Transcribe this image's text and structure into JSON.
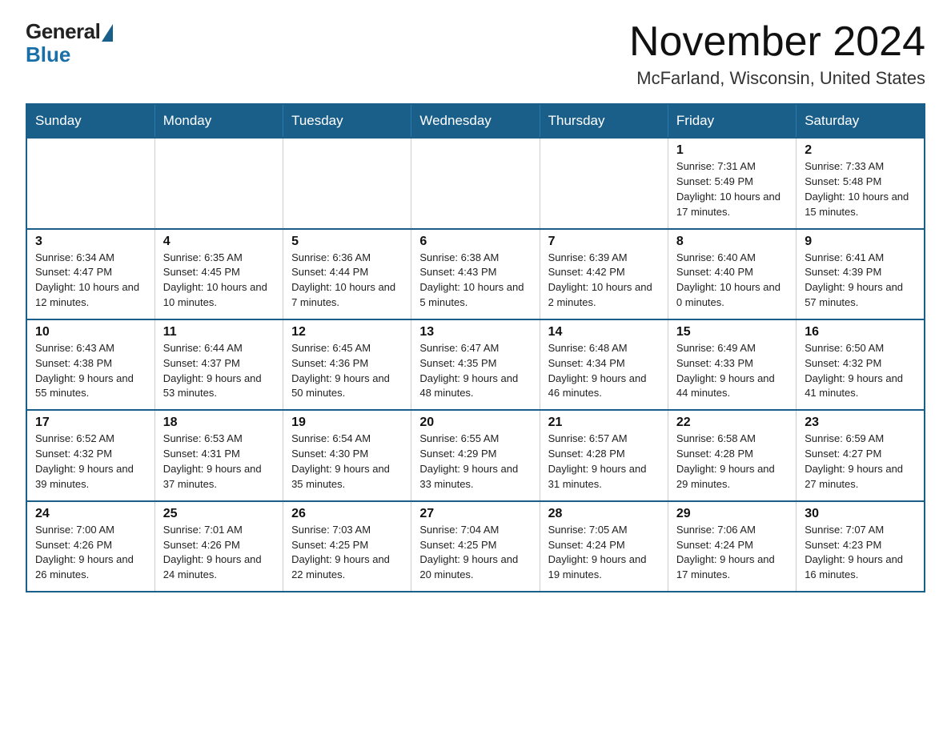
{
  "logo": {
    "text_general": "General",
    "text_blue": "Blue"
  },
  "header": {
    "title": "November 2024",
    "subtitle": "McFarland, Wisconsin, United States"
  },
  "days_of_week": [
    "Sunday",
    "Monday",
    "Tuesday",
    "Wednesday",
    "Thursday",
    "Friday",
    "Saturday"
  ],
  "weeks": [
    {
      "cells": [
        {
          "day": "",
          "info": ""
        },
        {
          "day": "",
          "info": ""
        },
        {
          "day": "",
          "info": ""
        },
        {
          "day": "",
          "info": ""
        },
        {
          "day": "",
          "info": ""
        },
        {
          "day": "1",
          "info": "Sunrise: 7:31 AM\nSunset: 5:49 PM\nDaylight: 10 hours\nand 17 minutes."
        },
        {
          "day": "2",
          "info": "Sunrise: 7:33 AM\nSunset: 5:48 PM\nDaylight: 10 hours\nand 15 minutes."
        }
      ]
    },
    {
      "cells": [
        {
          "day": "3",
          "info": "Sunrise: 6:34 AM\nSunset: 4:47 PM\nDaylight: 10 hours\nand 12 minutes."
        },
        {
          "day": "4",
          "info": "Sunrise: 6:35 AM\nSunset: 4:45 PM\nDaylight: 10 hours\nand 10 minutes."
        },
        {
          "day": "5",
          "info": "Sunrise: 6:36 AM\nSunset: 4:44 PM\nDaylight: 10 hours\nand 7 minutes."
        },
        {
          "day": "6",
          "info": "Sunrise: 6:38 AM\nSunset: 4:43 PM\nDaylight: 10 hours\nand 5 minutes."
        },
        {
          "day": "7",
          "info": "Sunrise: 6:39 AM\nSunset: 4:42 PM\nDaylight: 10 hours\nand 2 minutes."
        },
        {
          "day": "8",
          "info": "Sunrise: 6:40 AM\nSunset: 4:40 PM\nDaylight: 10 hours\nand 0 minutes."
        },
        {
          "day": "9",
          "info": "Sunrise: 6:41 AM\nSunset: 4:39 PM\nDaylight: 9 hours\nand 57 minutes."
        }
      ]
    },
    {
      "cells": [
        {
          "day": "10",
          "info": "Sunrise: 6:43 AM\nSunset: 4:38 PM\nDaylight: 9 hours\nand 55 minutes."
        },
        {
          "day": "11",
          "info": "Sunrise: 6:44 AM\nSunset: 4:37 PM\nDaylight: 9 hours\nand 53 minutes."
        },
        {
          "day": "12",
          "info": "Sunrise: 6:45 AM\nSunset: 4:36 PM\nDaylight: 9 hours\nand 50 minutes."
        },
        {
          "day": "13",
          "info": "Sunrise: 6:47 AM\nSunset: 4:35 PM\nDaylight: 9 hours\nand 48 minutes."
        },
        {
          "day": "14",
          "info": "Sunrise: 6:48 AM\nSunset: 4:34 PM\nDaylight: 9 hours\nand 46 minutes."
        },
        {
          "day": "15",
          "info": "Sunrise: 6:49 AM\nSunset: 4:33 PM\nDaylight: 9 hours\nand 44 minutes."
        },
        {
          "day": "16",
          "info": "Sunrise: 6:50 AM\nSunset: 4:32 PM\nDaylight: 9 hours\nand 41 minutes."
        }
      ]
    },
    {
      "cells": [
        {
          "day": "17",
          "info": "Sunrise: 6:52 AM\nSunset: 4:32 PM\nDaylight: 9 hours\nand 39 minutes."
        },
        {
          "day": "18",
          "info": "Sunrise: 6:53 AM\nSunset: 4:31 PM\nDaylight: 9 hours\nand 37 minutes."
        },
        {
          "day": "19",
          "info": "Sunrise: 6:54 AM\nSunset: 4:30 PM\nDaylight: 9 hours\nand 35 minutes."
        },
        {
          "day": "20",
          "info": "Sunrise: 6:55 AM\nSunset: 4:29 PM\nDaylight: 9 hours\nand 33 minutes."
        },
        {
          "day": "21",
          "info": "Sunrise: 6:57 AM\nSunset: 4:28 PM\nDaylight: 9 hours\nand 31 minutes."
        },
        {
          "day": "22",
          "info": "Sunrise: 6:58 AM\nSunset: 4:28 PM\nDaylight: 9 hours\nand 29 minutes."
        },
        {
          "day": "23",
          "info": "Sunrise: 6:59 AM\nSunset: 4:27 PM\nDaylight: 9 hours\nand 27 minutes."
        }
      ]
    },
    {
      "cells": [
        {
          "day": "24",
          "info": "Sunrise: 7:00 AM\nSunset: 4:26 PM\nDaylight: 9 hours\nand 26 minutes."
        },
        {
          "day": "25",
          "info": "Sunrise: 7:01 AM\nSunset: 4:26 PM\nDaylight: 9 hours\nand 24 minutes."
        },
        {
          "day": "26",
          "info": "Sunrise: 7:03 AM\nSunset: 4:25 PM\nDaylight: 9 hours\nand 22 minutes."
        },
        {
          "day": "27",
          "info": "Sunrise: 7:04 AM\nSunset: 4:25 PM\nDaylight: 9 hours\nand 20 minutes."
        },
        {
          "day": "28",
          "info": "Sunrise: 7:05 AM\nSunset: 4:24 PM\nDaylight: 9 hours\nand 19 minutes."
        },
        {
          "day": "29",
          "info": "Sunrise: 7:06 AM\nSunset: 4:24 PM\nDaylight: 9 hours\nand 17 minutes."
        },
        {
          "day": "30",
          "info": "Sunrise: 7:07 AM\nSunset: 4:23 PM\nDaylight: 9 hours\nand 16 minutes."
        }
      ]
    }
  ]
}
